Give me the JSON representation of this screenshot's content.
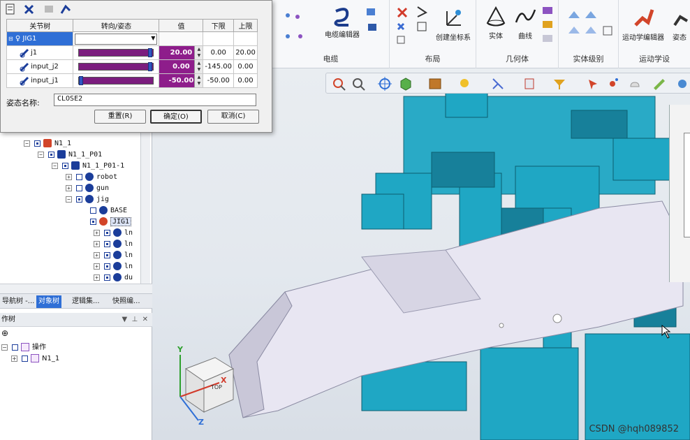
{
  "dialog": {
    "columns": [
      "关节树",
      "转向/姿态",
      "值",
      "下限",
      "上限"
    ],
    "root": {
      "label": "JIG1",
      "select_value": ""
    },
    "joints": [
      {
        "name": "j1",
        "value": "20.00",
        "lower": "0.00",
        "upper": "20.00",
        "slider": 0.99
      },
      {
        "name": "input_j2",
        "value": "0.00",
        "lower": "-145.00",
        "upper": "0.00",
        "slider": 0.99
      },
      {
        "name": "input_j1",
        "value": "-50.00",
        "lower": "-50.00",
        "upper": "0.00",
        "slider": 0.0
      }
    ],
    "pose_label": "姿态名称:",
    "pose_value": "CLOSE2",
    "buttons": {
      "reset": "重置(R)",
      "ok": "确定(O)",
      "cancel": "取消(C)"
    }
  },
  "ribbon": {
    "groups": [
      {
        "label": "电缆",
        "buttons": [
          "电缆编辑器"
        ]
      },
      {
        "label": "布局",
        "buttons": [
          "创建坐标系"
        ]
      },
      {
        "label": "几何体",
        "buttons": [
          "实体",
          "曲线"
        ]
      },
      {
        "label": "实体级别",
        "buttons": []
      },
      {
        "label": "运动学设",
        "buttons": [
          "运动学编辑器",
          "姿态"
        ]
      }
    ]
  },
  "tree": {
    "rows": [
      {
        "label": "N1_1",
        "depth": 0,
        "checked": true
      },
      {
        "label": "N1_1_P01",
        "depth": 1,
        "checked": true
      },
      {
        "label": "N1_1_P01-1",
        "depth": 2,
        "checked": true
      },
      {
        "label": "robot",
        "depth": 3,
        "checked": false
      },
      {
        "label": "gun",
        "depth": 3,
        "checked": false
      },
      {
        "label": "jig",
        "depth": 3,
        "checked": true
      },
      {
        "label": "BASE",
        "depth": 4,
        "checked": false
      },
      {
        "label": "JIG1",
        "depth": 4,
        "checked": true
      },
      {
        "label": "ln",
        "depth": 5,
        "checked": true
      },
      {
        "label": "ln",
        "depth": 5,
        "checked": true
      },
      {
        "label": "ln",
        "depth": 5,
        "checked": true
      },
      {
        "label": "ln",
        "depth": 5,
        "checked": true
      },
      {
        "label": "du",
        "depth": 5,
        "checked": true
      }
    ]
  },
  "tabs": [
    "导航树 -...",
    "对象树",
    "逻辑集...",
    "快照编..."
  ],
  "optree": {
    "title": "作树",
    "rows": [
      {
        "label": "操作",
        "depth": 0
      },
      {
        "label": "N1_1",
        "depth": 1
      }
    ]
  },
  "viewcube": {
    "face": "TOP",
    "axes": [
      "X",
      "Y",
      "Z"
    ]
  },
  "watermark": "CSDN @hqh089852",
  "colors": {
    "accent": "#2f6fd6",
    "value_bg": "#8e1d8b",
    "slider": "#7b1d7e",
    "model": "#1fa7c4",
    "part": "#e8e6f2"
  }
}
